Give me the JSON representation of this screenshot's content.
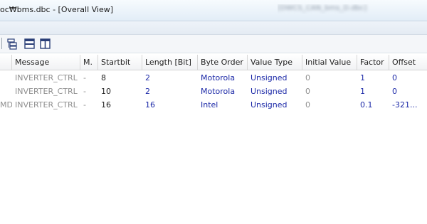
{
  "window": {
    "title": "oc₩bms.dbc - [Overall View]",
    "blurred_title": "[DWCS_CAN_bms_D.dbc]"
  },
  "toolbar": {
    "icons": [
      "tree-view-icon",
      "horizontal-split-icon",
      "vertical-split-icon"
    ]
  },
  "table": {
    "columns": [
      "",
      "Message",
      "M.",
      "Startbit",
      "Length [Bit]",
      "Byte Order",
      "Value Type",
      "Initial Value",
      "Factor",
      "Offset"
    ],
    "rows": [
      {
        "name": "",
        "message": "INVERTER_CTRL",
        "m": "-",
        "startbit": "8",
        "length": "2",
        "byte_order": "Motorola",
        "value_type": "Unsigned",
        "initial": "0",
        "factor": "1",
        "offset": "0"
      },
      {
        "name": "",
        "message": "INVERTER_CTRL",
        "m": "-",
        "startbit": "10",
        "length": "2",
        "byte_order": "Motorola",
        "value_type": "Unsigned",
        "initial": "0",
        "factor": "1",
        "offset": "0"
      },
      {
        "name": "MD",
        "message": "INVERTER_CTRL",
        "m": "-",
        "startbit": "16",
        "length": "16",
        "byte_order": "Intel",
        "value_type": "Unsigned",
        "initial": "0",
        "factor": "0.1",
        "offset": "-321..."
      }
    ]
  },
  "colors": {
    "value_blue": "#1d2aa8",
    "muted_grey": "#8e8e8e"
  }
}
